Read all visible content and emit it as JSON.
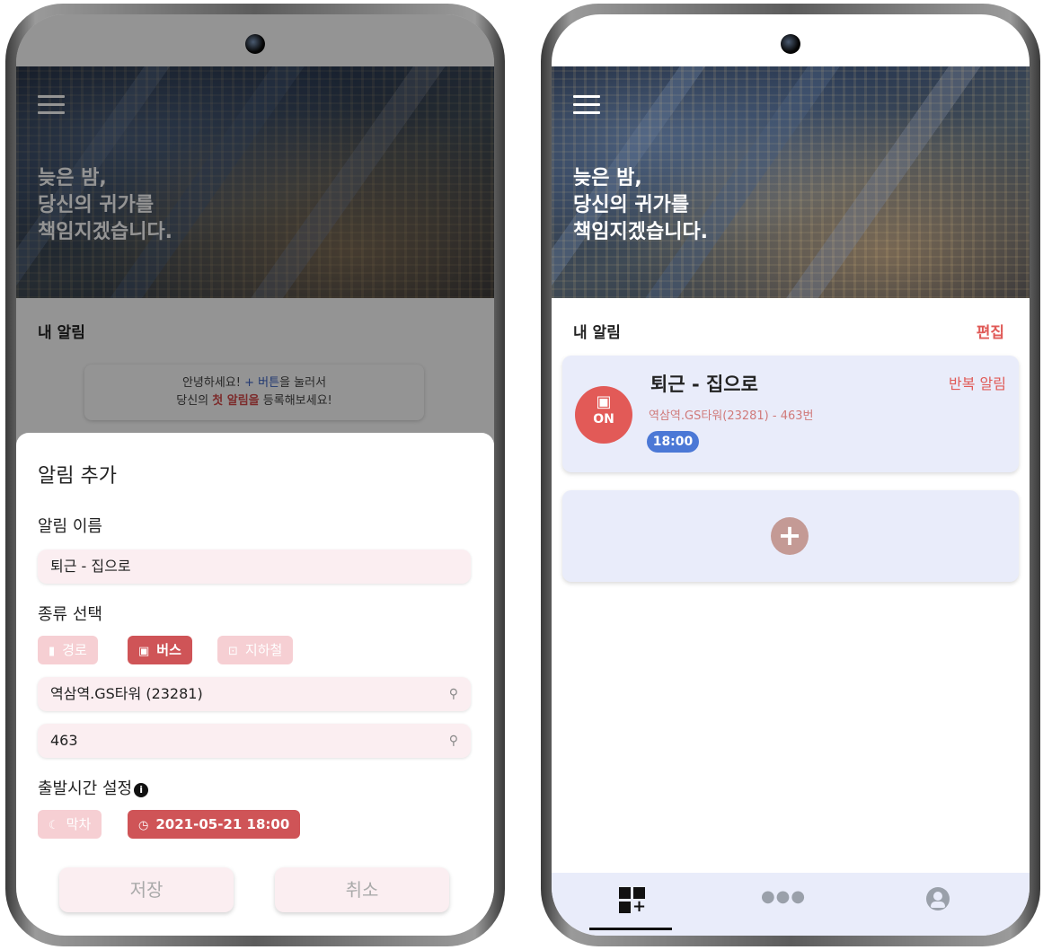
{
  "hero": {
    "slogan_lines": [
      "늦은 밤,",
      "당신의 귀가를",
      "책임지겠습니다."
    ]
  },
  "home": {
    "section_title": "내 알림",
    "edit_label": "편집",
    "greeting": {
      "line1_pre": "안녕하세요! ",
      "line1_highlight": "+ 버튼",
      "line1_post": "을 눌러서",
      "line2_pre": "당신의 ",
      "line2_highlight": "첫 알림을",
      "line2_post": " 등록해보세요!"
    }
  },
  "add_sheet": {
    "title": "알림 추가",
    "name_label": "알림 이름",
    "name_value": "퇴근 - 집으로",
    "type_label": "종류 선택",
    "types": [
      {
        "label": "경로",
        "state": "inactive"
      },
      {
        "label": "버스",
        "state": "active"
      },
      {
        "label": "지하철",
        "state": "inactive"
      }
    ],
    "stop_value": "역삼역.GS타워 (23281)",
    "route_value": "463",
    "departure_label": "출발시간 설정",
    "last_train_label": "막차",
    "datetime_value": "2021-05-21 18:00",
    "save_label": "저장",
    "cancel_label": "취소"
  },
  "alarm_card": {
    "badge_label": "ON",
    "name": "퇴근 - 집으로",
    "repeat_label": "반복 알림",
    "detail": "역삼역.GS타워(23281) - 463번",
    "time": "18:00"
  },
  "colors": {
    "accent_red": "#cf5457",
    "pale_pink": "#f6cfd3",
    "card_bg": "#e9ecfa",
    "time_blue": "#4b78d6"
  }
}
